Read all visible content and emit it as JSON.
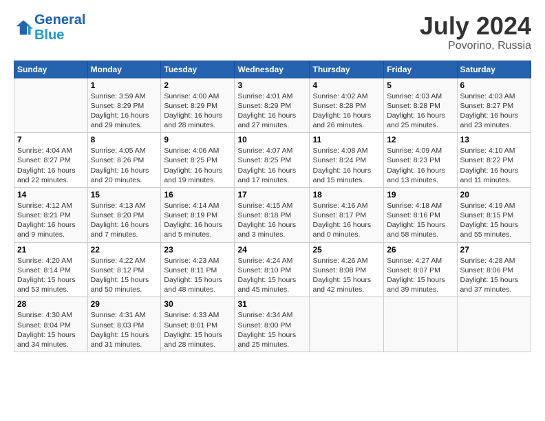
{
  "header": {
    "logo_line1": "General",
    "logo_line2": "Blue",
    "month_year": "July 2024",
    "location": "Povorino, Russia"
  },
  "weekdays": [
    "Sunday",
    "Monday",
    "Tuesday",
    "Wednesday",
    "Thursday",
    "Friday",
    "Saturday"
  ],
  "weeks": [
    [
      {
        "day": "",
        "text": ""
      },
      {
        "day": "1",
        "text": "Sunrise: 3:59 AM\nSunset: 8:29 PM\nDaylight: 16 hours\nand 29 minutes."
      },
      {
        "day": "2",
        "text": "Sunrise: 4:00 AM\nSunset: 8:29 PM\nDaylight: 16 hours\nand 28 minutes."
      },
      {
        "day": "3",
        "text": "Sunrise: 4:01 AM\nSunset: 8:29 PM\nDaylight: 16 hours\nand 27 minutes."
      },
      {
        "day": "4",
        "text": "Sunrise: 4:02 AM\nSunset: 8:28 PM\nDaylight: 16 hours\nand 26 minutes."
      },
      {
        "day": "5",
        "text": "Sunrise: 4:03 AM\nSunset: 8:28 PM\nDaylight: 16 hours\nand 25 minutes."
      },
      {
        "day": "6",
        "text": "Sunrise: 4:03 AM\nSunset: 8:27 PM\nDaylight: 16 hours\nand 23 minutes."
      }
    ],
    [
      {
        "day": "7",
        "text": "Sunrise: 4:04 AM\nSunset: 8:27 PM\nDaylight: 16 hours\nand 22 minutes."
      },
      {
        "day": "8",
        "text": "Sunrise: 4:05 AM\nSunset: 8:26 PM\nDaylight: 16 hours\nand 20 minutes."
      },
      {
        "day": "9",
        "text": "Sunrise: 4:06 AM\nSunset: 8:25 PM\nDaylight: 16 hours\nand 19 minutes."
      },
      {
        "day": "10",
        "text": "Sunrise: 4:07 AM\nSunset: 8:25 PM\nDaylight: 16 hours\nand 17 minutes."
      },
      {
        "day": "11",
        "text": "Sunrise: 4:08 AM\nSunset: 8:24 PM\nDaylight: 16 hours\nand 15 minutes."
      },
      {
        "day": "12",
        "text": "Sunrise: 4:09 AM\nSunset: 8:23 PM\nDaylight: 16 hours\nand 13 minutes."
      },
      {
        "day": "13",
        "text": "Sunrise: 4:10 AM\nSunset: 8:22 PM\nDaylight: 16 hours\nand 11 minutes."
      }
    ],
    [
      {
        "day": "14",
        "text": "Sunrise: 4:12 AM\nSunset: 8:21 PM\nDaylight: 16 hours\nand 9 minutes."
      },
      {
        "day": "15",
        "text": "Sunrise: 4:13 AM\nSunset: 8:20 PM\nDaylight: 16 hours\nand 7 minutes."
      },
      {
        "day": "16",
        "text": "Sunrise: 4:14 AM\nSunset: 8:19 PM\nDaylight: 16 hours\nand 5 minutes."
      },
      {
        "day": "17",
        "text": "Sunrise: 4:15 AM\nSunset: 8:18 PM\nDaylight: 16 hours\nand 3 minutes."
      },
      {
        "day": "18",
        "text": "Sunrise: 4:16 AM\nSunset: 8:17 PM\nDaylight: 16 hours\nand 0 minutes."
      },
      {
        "day": "19",
        "text": "Sunrise: 4:18 AM\nSunset: 8:16 PM\nDaylight: 15 hours\nand 58 minutes."
      },
      {
        "day": "20",
        "text": "Sunrise: 4:19 AM\nSunset: 8:15 PM\nDaylight: 15 hours\nand 55 minutes."
      }
    ],
    [
      {
        "day": "21",
        "text": "Sunrise: 4:20 AM\nSunset: 8:14 PM\nDaylight: 15 hours\nand 53 minutes."
      },
      {
        "day": "22",
        "text": "Sunrise: 4:22 AM\nSunset: 8:12 PM\nDaylight: 15 hours\nand 50 minutes."
      },
      {
        "day": "23",
        "text": "Sunrise: 4:23 AM\nSunset: 8:11 PM\nDaylight: 15 hours\nand 48 minutes."
      },
      {
        "day": "24",
        "text": "Sunrise: 4:24 AM\nSunset: 8:10 PM\nDaylight: 15 hours\nand 45 minutes."
      },
      {
        "day": "25",
        "text": "Sunrise: 4:26 AM\nSunset: 8:08 PM\nDaylight: 15 hours\nand 42 minutes."
      },
      {
        "day": "26",
        "text": "Sunrise: 4:27 AM\nSunset: 8:07 PM\nDaylight: 15 hours\nand 39 minutes."
      },
      {
        "day": "27",
        "text": "Sunrise: 4:28 AM\nSunset: 8:06 PM\nDaylight: 15 hours\nand 37 minutes."
      }
    ],
    [
      {
        "day": "28",
        "text": "Sunrise: 4:30 AM\nSunset: 8:04 PM\nDaylight: 15 hours\nand 34 minutes."
      },
      {
        "day": "29",
        "text": "Sunrise: 4:31 AM\nSunset: 8:03 PM\nDaylight: 15 hours\nand 31 minutes."
      },
      {
        "day": "30",
        "text": "Sunrise: 4:33 AM\nSunset: 8:01 PM\nDaylight: 15 hours\nand 28 minutes."
      },
      {
        "day": "31",
        "text": "Sunrise: 4:34 AM\nSunset: 8:00 PM\nDaylight: 15 hours\nand 25 minutes."
      },
      {
        "day": "",
        "text": ""
      },
      {
        "day": "",
        "text": ""
      },
      {
        "day": "",
        "text": ""
      }
    ]
  ]
}
